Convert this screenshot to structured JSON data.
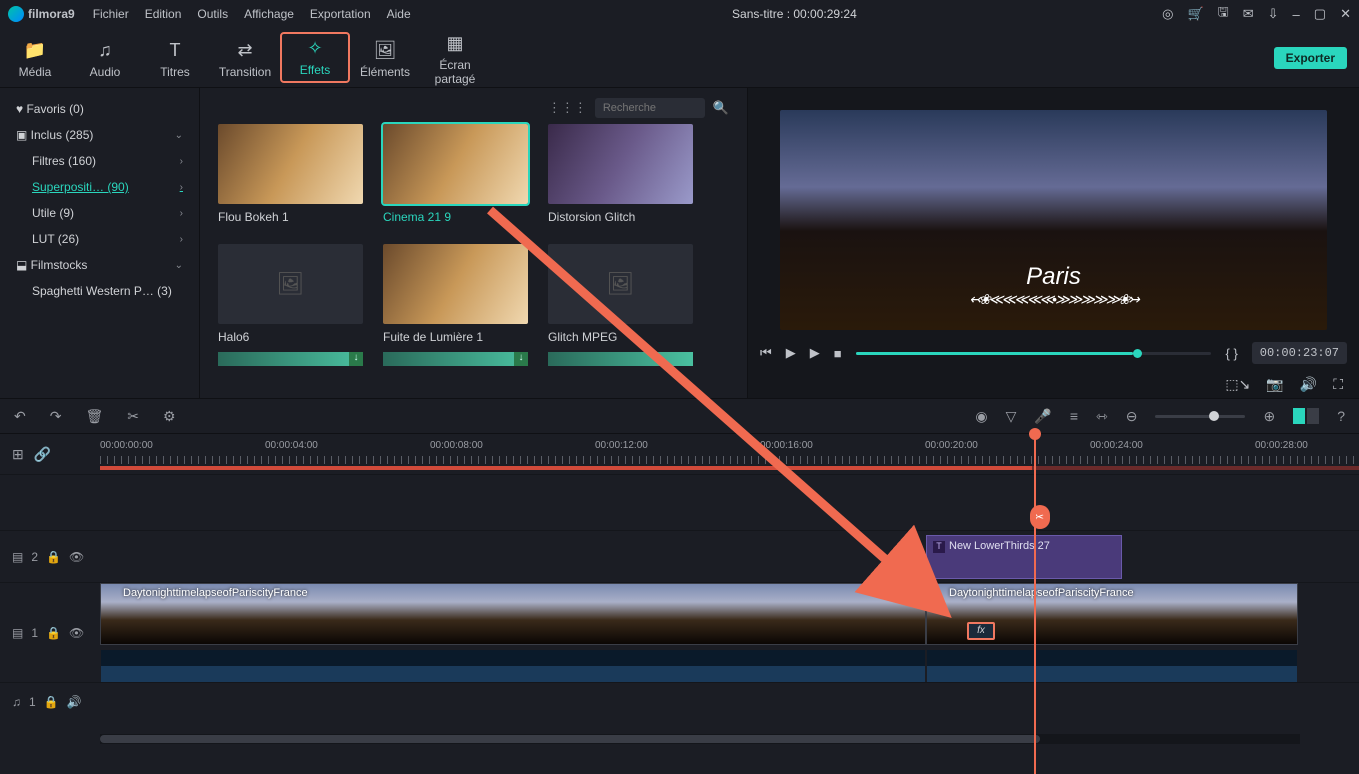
{
  "menubar": {
    "logo": "filmora9",
    "items": [
      "Fichier",
      "Edition",
      "Outils",
      "Affichage",
      "Exportation",
      "Aide"
    ],
    "title": "Sans-titre : 00:00:29:24"
  },
  "toolbar": {
    "items": [
      {
        "label": "Média",
        "icon": "📁"
      },
      {
        "label": "Audio",
        "icon": "♫"
      },
      {
        "label": "Titres",
        "icon": "T"
      },
      {
        "label": "Transition",
        "icon": "⇄"
      },
      {
        "label": "Effets",
        "icon": "✧",
        "active": true
      },
      {
        "label": "Éléments",
        "icon": "🖼"
      },
      {
        "label": "Écran partagé",
        "icon": "▦"
      }
    ],
    "export": "Exporter"
  },
  "sidebar": {
    "favoris": "Favoris (0)",
    "inclus": "Inclus (285)",
    "children": [
      {
        "label": "Filtres (160)"
      },
      {
        "label": "Superpositi… (90)",
        "active": true
      },
      {
        "label": "Utile (9)"
      },
      {
        "label": "LUT (26)"
      }
    ],
    "filmstocks": "Filmstocks",
    "spaghetti": "Spaghetti Western P… (3)"
  },
  "gallery": {
    "search_placeholder": "Recherche",
    "items": [
      {
        "label": "Flou Bokeh 1",
        "type": "warm"
      },
      {
        "label": "Cinema 21 9",
        "type": "warm",
        "selected": true
      },
      {
        "label": "Distorsion Glitch",
        "type": "glitch"
      },
      {
        "label": "Halo6",
        "type": "ph"
      },
      {
        "label": "Fuite de Lumière 1",
        "type": "warm"
      },
      {
        "label": "Glitch MPEG",
        "type": "ph"
      }
    ]
  },
  "preview": {
    "paris": "Paris",
    "timecode": "00:00:23:07",
    "brackets": "{  }"
  },
  "timeline": {
    "ticks": [
      "00:00:00:00",
      "00:00:04:00",
      "00:00:08:00",
      "00:00:12:00",
      "00:00:16:00",
      "00:00:20:00",
      "00:00:24:00",
      "00:00:28:00"
    ],
    "title_track_num": "2",
    "video_track_num": "1",
    "audio_track_num": "1",
    "title_clip": "New LowerThirds 27",
    "clip1_label": "DaytonighttimelapseofPariscityFrance",
    "clip2_label": "DaytonighttimelapseofPariscityFrance",
    "fx": "fx"
  }
}
